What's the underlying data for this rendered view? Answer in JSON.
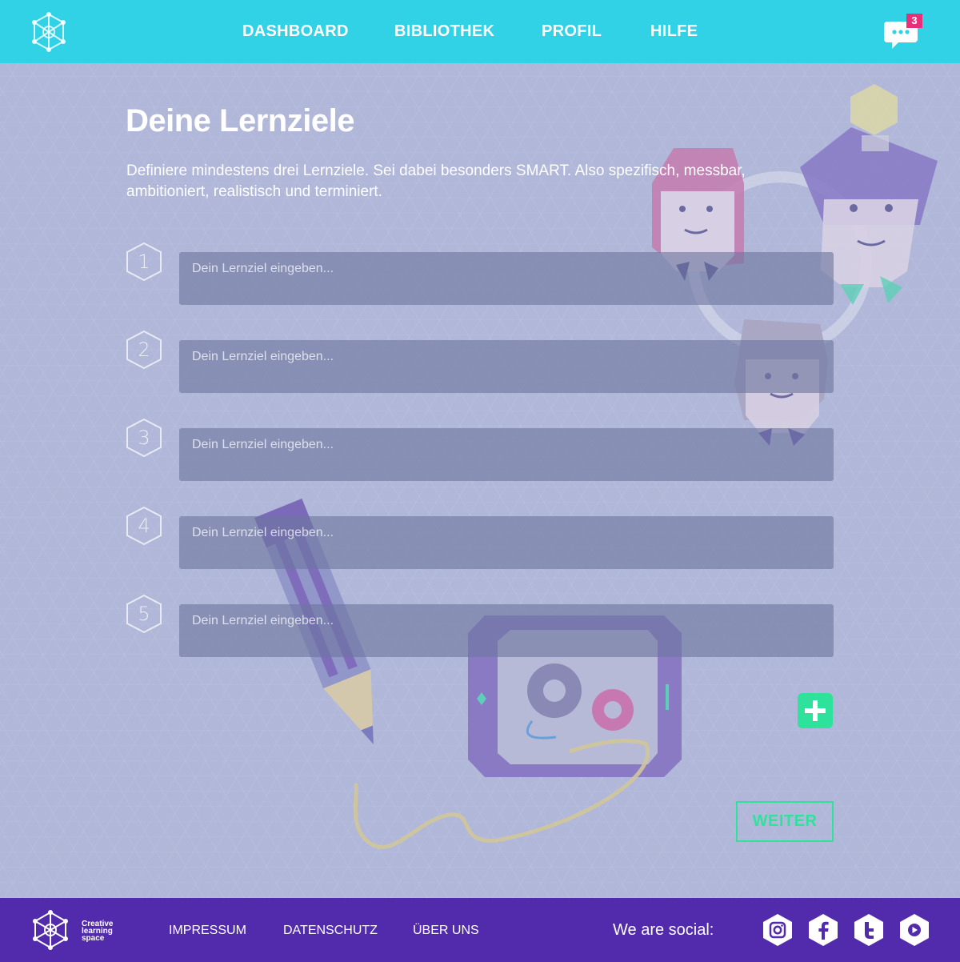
{
  "header": {
    "nav": [
      "DASHBOARD",
      "BIBLIOTHEK",
      "PROFIL",
      "HILFE"
    ],
    "message_count": "3"
  },
  "main": {
    "title": "Deine Lernziele",
    "description": "Definiere mindestens drei Lernziele. Sei dabei besonders SMART.  Also spezifisch, messbar, ambitioniert, realistisch und terminiert.",
    "goals": [
      {
        "number": "1",
        "placeholder": "Dein Lernziel eingeben...",
        "value": ""
      },
      {
        "number": "2",
        "placeholder": "Dein Lernziel eingeben...",
        "value": ""
      },
      {
        "number": "3",
        "placeholder": "Dein Lernziel eingeben...",
        "value": ""
      },
      {
        "number": "4",
        "placeholder": "Dein Lernziel eingeben...",
        "value": ""
      },
      {
        "number": "5",
        "placeholder": "Dein Lernziel eingeben...",
        "value": ""
      }
    ],
    "add_icon": "plus-icon",
    "next_label": "WEITER"
  },
  "footer": {
    "brand": [
      "Creative",
      "learning",
      "space"
    ],
    "links": [
      "IMPRESSUM",
      "DATENSCHUTZ",
      "ÜBER UNS"
    ],
    "social_label": "We are social:",
    "social_icons": [
      "instagram-icon",
      "facebook-icon",
      "twitter-icon",
      "youtube-icon"
    ]
  },
  "colors": {
    "header": "#31d1e6",
    "footer": "#522aac",
    "accent": "#2fe29b",
    "badge": "#e6307a"
  }
}
